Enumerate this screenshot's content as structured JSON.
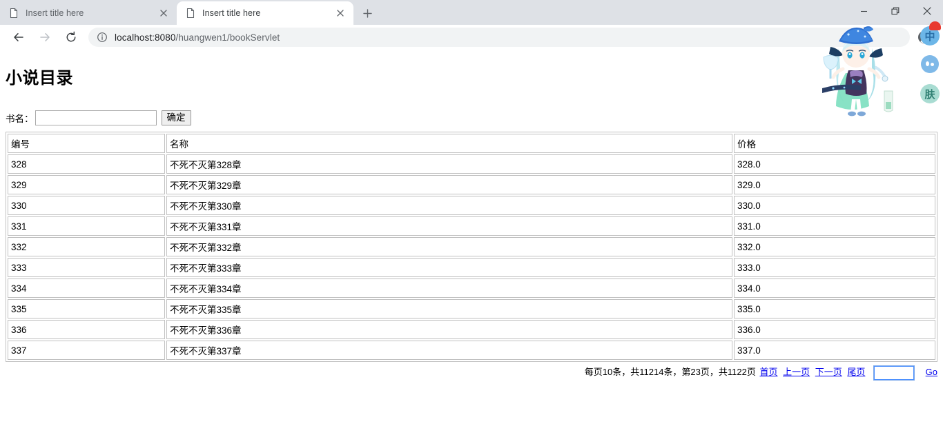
{
  "browser": {
    "tabs": [
      {
        "title": "Insert title here",
        "active": false,
        "icon": "page-icon",
        "close_label": "×"
      },
      {
        "title": "Insert title here",
        "active": true,
        "icon": "page-icon",
        "close_label": "×"
      }
    ],
    "new_tab_label": "+",
    "window_controls": {
      "minimize": "–",
      "maximize": "❐",
      "close": "×"
    },
    "toolbar": {
      "back_icon": "back-arrow-icon",
      "forward_icon": "forward-arrow-icon",
      "reload_icon": "reload-icon",
      "info_icon": "site-info-icon",
      "profile_icon": "profile-avatar-icon",
      "url_host": "localhost:8080",
      "url_path": "/huangwen1/bookServlet"
    }
  },
  "page": {
    "title": "小说目录",
    "search": {
      "label": "书名：",
      "input_value": "",
      "input_placeholder": "",
      "submit_label": "确定"
    },
    "table": {
      "headers": [
        "编号",
        "名称",
        "价格"
      ],
      "rows": [
        {
          "id": "328",
          "name": "不死不灭第328章",
          "price": "328.0"
        },
        {
          "id": "329",
          "name": "不死不灭第329章",
          "price": "329.0"
        },
        {
          "id": "330",
          "name": "不死不灭第330章",
          "price": "330.0"
        },
        {
          "id": "331",
          "name": "不死不灭第331章",
          "price": "331.0"
        },
        {
          "id": "332",
          "name": "不死不灭第332章",
          "price": "332.0"
        },
        {
          "id": "333",
          "name": "不死不灭第333章",
          "price": "333.0"
        },
        {
          "id": "334",
          "name": "不死不灭第334章",
          "price": "334.0"
        },
        {
          "id": "335",
          "name": "不死不灭第335章",
          "price": "335.0"
        },
        {
          "id": "336",
          "name": "不死不灭第336章",
          "price": "336.0"
        },
        {
          "id": "337",
          "name": "不死不灭第337章",
          "price": "337.0"
        }
      ]
    },
    "pagination": {
      "summary": "每页10条，共11214条，第23页，共1122页",
      "per_page": 10,
      "total_records": 11214,
      "current_page": 23,
      "total_pages": 1122,
      "first_label": "首页",
      "prev_label": "上一页",
      "next_label": "下一页",
      "last_label": "尾页",
      "jump_value": "",
      "go_label": "Go"
    }
  },
  "overlay": {
    "mascot_name": "anime-mascot-character",
    "side_icons": [
      {
        "name": "ime-chinese-badge",
        "label": "中"
      },
      {
        "name": "ime-status-dots-badge",
        "label": ""
      },
      {
        "name": "ime-skin-badge",
        "label": "肤"
      }
    ]
  },
  "colors": {
    "tabstrip_bg": "#dee1e6",
    "omnibox_bg": "#f1f3f4",
    "link": "#0000ee",
    "table_border": "#c0c0c0",
    "badge_blue": "#6cb6e8",
    "badge_teal": "#a9dcd2",
    "badge_red": "#e8392f"
  }
}
